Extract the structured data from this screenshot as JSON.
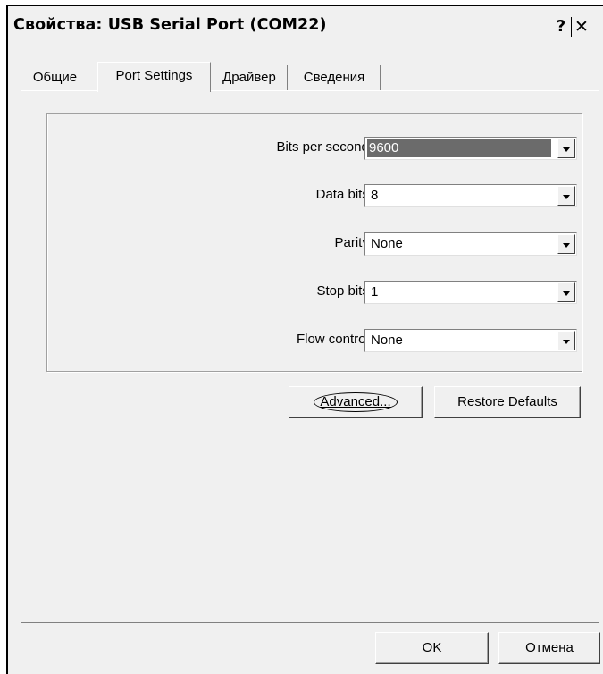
{
  "window": {
    "title": "Свойства: USB Serial Port (COM22)",
    "help_label": "?",
    "close_label": "✕"
  },
  "tabs": [
    {
      "label": "Общие",
      "active": false
    },
    {
      "label": "Port Settings",
      "active": true
    },
    {
      "label": "Драйвер",
      "active": false
    },
    {
      "label": "Сведения",
      "active": false
    }
  ],
  "settings": {
    "bits_per_second": {
      "label": "Bits per second:",
      "value": "9600"
    },
    "data_bits": {
      "label": "Data bits:",
      "value": "8"
    },
    "parity": {
      "label": "Parity:",
      "value": "None"
    },
    "stop_bits": {
      "label": "Stop bits:",
      "value": "1"
    },
    "flow_control": {
      "label": "Flow control:",
      "value": "None"
    }
  },
  "buttons": {
    "advanced": "Advanced...",
    "restore_defaults": "Restore Defaults",
    "ok": "OK",
    "cancel": "Отмена"
  },
  "colors": {
    "dialog_bg": "#f0f0f0",
    "selection_bg": "#6b6b6b"
  }
}
